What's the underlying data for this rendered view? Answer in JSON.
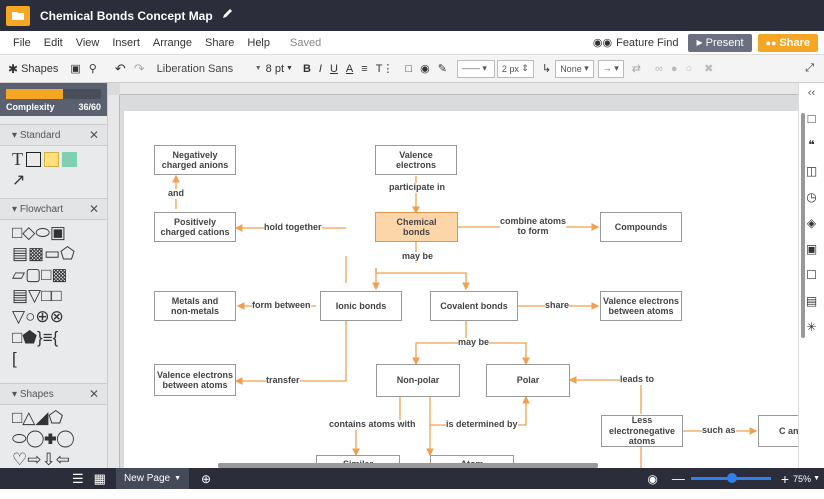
{
  "doc_title": "Chemical Bonds Concept Map",
  "menu": [
    "File",
    "Edit",
    "View",
    "Insert",
    "Arrange",
    "Share",
    "Help"
  ],
  "saved_status": "Saved",
  "feature_find": "Feature Find",
  "present_label": "Present",
  "share_label": "Share",
  "toolbar": {
    "shapes_label": "Shapes",
    "font": "Liberation Sans",
    "font_size": "8 pt",
    "line_width": "2 px",
    "arrow_start": "None"
  },
  "complexity": {
    "label": "Complexity",
    "value": "36/60",
    "fraction": 0.6
  },
  "panels": {
    "standard": "Standard",
    "flowchart": "Flowchart",
    "shapes": "Shapes"
  },
  "bottom": {
    "page_label": "New Page",
    "zoom": "75%"
  },
  "nodes": {
    "neg_anions": "Negatively\ncharged anions",
    "valence": "Valence\nelectrons",
    "pos_cations": "Positively\ncharged cations",
    "chem_bonds": "Chemical\nbonds",
    "compounds": "Compounds",
    "metals": "Metals and\nnon-metals",
    "ionic": "Ionic bonds",
    "covalent": "Covalent bonds",
    "valence_between": "Valence electrons\nbetween atoms",
    "valence_between2": "Valence electrons\nbetween atoms",
    "nonpolar": "Non-polar",
    "polar": "Polar",
    "less_electroneg": "Less\nelectronegative\natoms",
    "can": "C an",
    "similar": "Similar",
    "atom": "Atom"
  },
  "edges": {
    "and": "and",
    "participate_in": "participate in",
    "hold_together": "hold together",
    "combine_atoms": "combine atoms\nto form",
    "may_be": "may be",
    "form_between": "form between",
    "share": "share",
    "may_be2": "may be",
    "transfer": "transfer",
    "leads_to": "leads to",
    "contains_atoms_with": "contains atoms with",
    "is_determined_by": "is determined by",
    "such_as": "such as"
  },
  "colors": {
    "accent": "#f5a623",
    "edge": "#f0a050",
    "highlight_fill": "#fcd6a8",
    "dark_bar": "#2b2e3a"
  }
}
